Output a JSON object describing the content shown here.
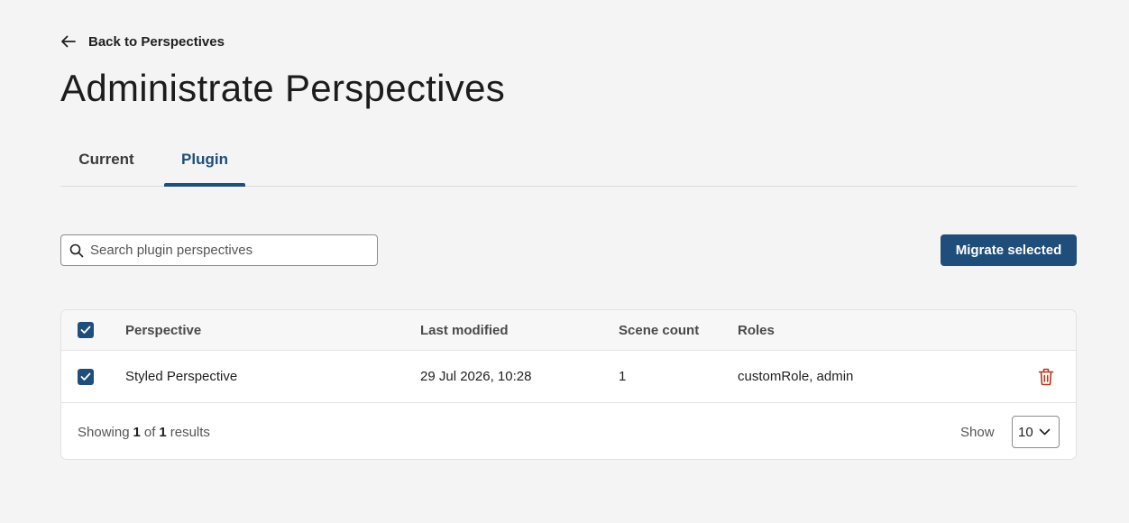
{
  "back_link": {
    "label": "Back to Perspectives"
  },
  "page_title": "Administrate Perspectives",
  "tabs": [
    {
      "label": "Current",
      "active": false
    },
    {
      "label": "Plugin",
      "active": true
    }
  ],
  "search": {
    "placeholder": "Search plugin perspectives",
    "value": ""
  },
  "toolbar": {
    "migrate_label": "Migrate selected"
  },
  "table": {
    "select_all_checked": true,
    "columns": [
      "Perspective",
      "Last modified",
      "Scene count",
      "Roles"
    ],
    "rows": [
      {
        "selected": true,
        "perspective": "Styled Perspective",
        "last_modified": "29 Jul 2026, 10:28",
        "scene_count": "1",
        "roles": "customRole, admin",
        "action_icon": "trash-icon"
      }
    ]
  },
  "footer": {
    "showing_prefix": "Showing",
    "showing_from": "1",
    "showing_of": "of",
    "showing_total": "1",
    "showing_suffix": "results",
    "show_label": "Show",
    "page_size": "10"
  },
  "colors": {
    "accent": "#1f4e7a",
    "delete": "#b5371b",
    "background": "#f4f4f4"
  }
}
